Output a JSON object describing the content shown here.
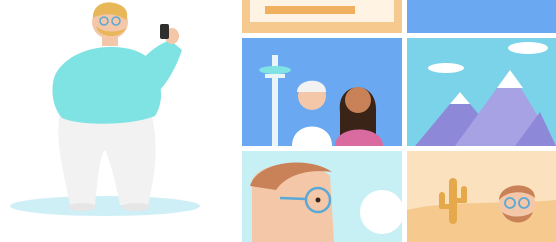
{
  "illustration": {
    "subject": "person-taking-photo-with-photo-grid",
    "colors": {
      "background": "#ffffff",
      "shirt": "#7fe3e3",
      "pants": "#f2f2f2",
      "skin": "#f3c7a8",
      "hair": "#e8b75a",
      "shadow": "#cfeff7",
      "tile_sky": "#6aa9f2",
      "tile_mountain_sky": "#7bd3ea",
      "tile_mountain": "#8e88d9",
      "tile_cyan": "#c6f0f4",
      "tile_desert": "#f6c98e",
      "tile_cactus": "#e5a84a",
      "accent_orange": "#f0b060"
    }
  }
}
